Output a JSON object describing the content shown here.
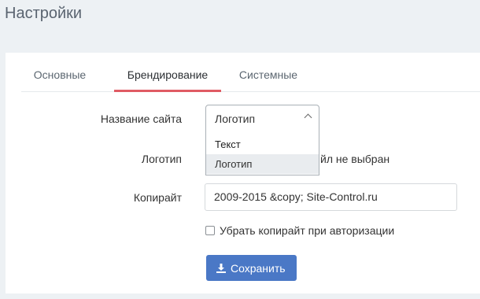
{
  "page": {
    "title": "Настройки"
  },
  "tabs": [
    {
      "label": "Основные"
    },
    {
      "label": "Брендирование"
    },
    {
      "label": "Системные"
    }
  ],
  "form": {
    "site_name": {
      "label": "Название сайта",
      "value": "Логотип",
      "options": [
        "Текст",
        "Логотип"
      ]
    },
    "logo": {
      "label": "Логотип",
      "file_status": "йл не выбран"
    },
    "copyright": {
      "label": "Копирайт",
      "value": "2009-2015 &copy; Site-Control.ru"
    },
    "hide_copyright": {
      "label": "Убрать копирайт при авторизации",
      "checked": false
    },
    "save_label": "Сохранить"
  },
  "colors": {
    "accent": "#e05b64",
    "button": "#4a78c6",
    "background": "#edf1f4"
  }
}
